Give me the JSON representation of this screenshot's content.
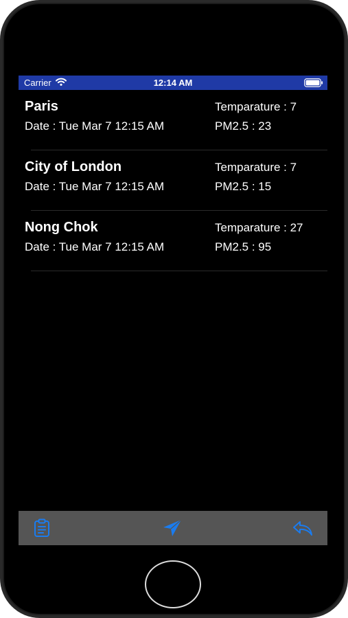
{
  "status_bar": {
    "carrier": "Carrier",
    "time": "12:14 AM",
    "background_color": "#1f3aa6"
  },
  "rows": [
    {
      "city": "Paris",
      "date": "Date : Tue Mar 7 12:15 AM",
      "temperature": "Temparature : 7",
      "pm25": "PM2.5 : 23"
    },
    {
      "city": "City of London",
      "date": "Date : Tue Mar 7 12:15 AM",
      "temperature": "Temparature : 7",
      "pm25": "PM2.5 : 15"
    },
    {
      "city": "Nong Chok",
      "date": "Date : Tue Mar 7 12:15 AM",
      "temperature": "Temparature : 27",
      "pm25": "PM2.5 : 95"
    }
  ],
  "toolbar": {
    "icons": [
      "clipboard-icon",
      "send-location-icon",
      "reply-icon"
    ],
    "accent_color": "#1a7cf0",
    "background_color": "#555555"
  }
}
